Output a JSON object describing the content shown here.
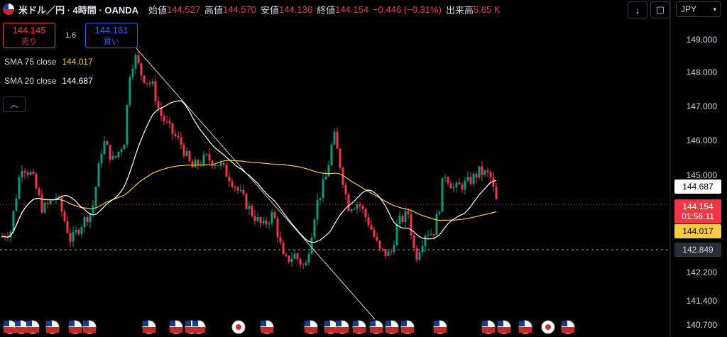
{
  "header": {
    "symbol": "米ドル／円 · 4時間 · OANDA",
    "open_label": "始値",
    "open": "144.527",
    "high_label": "高値",
    "high": "144.570",
    "low_label": "安値",
    "low": "144.136",
    "close_label": "終値",
    "close": "144.154",
    "change": "−0.446 (−0.31%)",
    "volume_label": "出来高",
    "volume": "5.65 K"
  },
  "trade": {
    "sell_price": "144.145",
    "sell_label": "売り",
    "spread": "1.6",
    "buy_price": "144.161",
    "buy_label": "買い"
  },
  "indicators": [
    {
      "name": "SMA 75 close",
      "value": "144.017",
      "color": "#f7c948"
    },
    {
      "name": "SMA 20 close",
      "value": "144.687",
      "color": "#ffffff"
    }
  ],
  "toolbar": {
    "collapse_icon": "chevron-up-icon",
    "download_icon": "arrow-down-icon",
    "layout_icon": "square-icon",
    "currency": "JPY"
  },
  "colors": {
    "up": "#089981",
    "down": "#f23645",
    "sma20": "#ffffff",
    "sma75": "#f7c948",
    "trendline": "#d1d4dc"
  },
  "chart_data": {
    "type": "candlestick",
    "yticks": [
      "149.000",
      "148.000",
      "147.000",
      "146.000",
      "145.000",
      "142.200",
      "141.400",
      "140.700"
    ],
    "ylim": [
      140.7,
      149.0
    ],
    "price_labels": [
      {
        "name": "sma20",
        "value": "144.687",
        "bg": "#ffffff",
        "fg": "#000000"
      },
      {
        "name": "last",
        "value": "144.154",
        "countdown": "01:56:11",
        "bg": "#f23645",
        "fg": "#ffffff"
      },
      {
        "name": "sma75",
        "value": "144.017",
        "bg": "#f7c948",
        "fg": "#000000"
      },
      {
        "name": "crosshair",
        "value": "142.849",
        "bg": "#2a2e39",
        "fg": "#d1d4dc"
      }
    ]
  }
}
